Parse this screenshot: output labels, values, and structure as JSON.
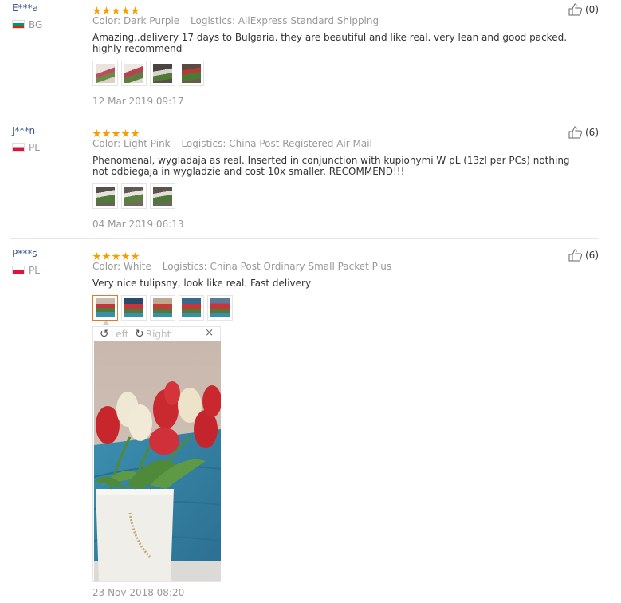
{
  "reviews": [
    {
      "user": "E***a",
      "country": "BG",
      "rating": 5,
      "color_label": "Color:",
      "color": "Dark Purple",
      "logistics_label": "Logistics:",
      "logistics": "AliExpress Standard Shipping",
      "text": "Amazing..delivery 17 days to Bulgaria. they are beautiful and like real. very lean and good packed. highly recommend",
      "photos": 4,
      "date": "12 Mar 2019 09:17",
      "helpful": "(0)"
    },
    {
      "user": "J***n",
      "country": "PL",
      "rating": 5,
      "color_label": "Color:",
      "color": "Light Pink",
      "logistics_label": "Logistics:",
      "logistics": "China Post Registered Air Mail",
      "text": "Phenomenal, wygladaja as real. Inserted in conjunction with kupionymi W pL (13zl per PCs) nothing not odbiegaja in wygladzie and cost 10x smaller. RECOMMEND!!!",
      "photos": 3,
      "date": "04 Mar 2019 06:13",
      "helpful": "(6)"
    },
    {
      "user": "P***s",
      "country": "PL",
      "rating": 5,
      "color_label": "Color:",
      "color": "White",
      "logistics_label": "Logistics:",
      "logistics": "China Post Ordinary Small Packet Plus",
      "text": "Very nice tulipsny, look like real. Fast delivery",
      "photos": 5,
      "date": "23 Nov 2018 08:20",
      "helpful": "(6)"
    }
  ],
  "viewer": {
    "left_label": "Left",
    "right_label": "Right",
    "close": "×"
  },
  "colors": {
    "star": "#f5a000",
    "active_thumb_border": "#e07a2a",
    "username": "#3a5a8a"
  }
}
